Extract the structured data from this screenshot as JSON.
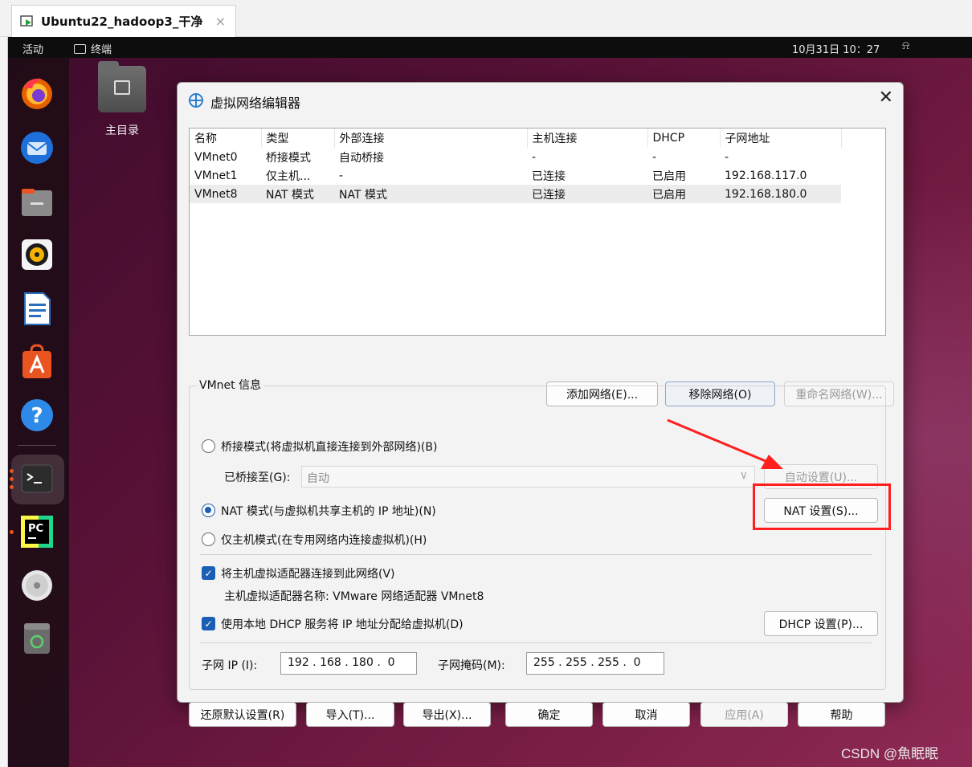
{
  "host": {
    "tab_title": "Ubuntu22_hadoop3_干净",
    "tab_close": "×"
  },
  "ubuntu": {
    "activities": "活动",
    "app_name": "终端",
    "clock": "10月31日 10：27",
    "bell": "⍾",
    "home_label": "主目录"
  },
  "dock": {
    "items": [
      "firefox-icon",
      "thunderbird-icon",
      "files-icon",
      "rhythmbox-icon",
      "libreoffice-writer-icon",
      "app-center-icon",
      "help-icon",
      "terminal-icon",
      "pycharm-icon",
      "optical-disc-icon",
      "trash-icon"
    ]
  },
  "dialog": {
    "title": "虚拟网络编辑器",
    "close": "✕",
    "table": {
      "headers": [
        "名称",
        "类型",
        "外部连接",
        "主机连接",
        "DHCP",
        "子网地址"
      ],
      "rows": [
        [
          "VMnet0",
          "桥接模式",
          "自动桥接",
          "-",
          "-",
          "-"
        ],
        [
          "VMnet1",
          "仅主机...",
          "-",
          "已连接",
          "已启用",
          "192.168.117.0"
        ],
        [
          "VMnet8",
          "NAT 模式",
          "NAT 模式",
          "已连接",
          "已启用",
          "192.168.180.0"
        ]
      ]
    },
    "table_buttons": {
      "add": "添加网络(E)...",
      "remove": "移除网络(O)",
      "rename": "重命名网络(W)..."
    },
    "group_label": "VMnet 信息",
    "bridge_radio": "桥接模式(将虚拟机直接连接到外部网络)(B)",
    "bridged_to_label": "已桥接至(G):",
    "bridged_to_value": "自动",
    "auto_settings": "自动设置(U)...",
    "nat_radio": "NAT 模式(与虚拟机共享主机的 IP 地址)(N)",
    "nat_settings": "NAT 设置(S)...",
    "host_only_radio": "仅主机模式(在专用网络内连接虚拟机)(H)",
    "connect_adapter": "将主机虚拟适配器连接到此网络(V)",
    "adapter_name": "主机虚拟适配器名称: VMware 网络适配器 VMnet8",
    "use_dhcp": "使用本地 DHCP 服务将 IP 地址分配给虚拟机(D)",
    "dhcp_settings": "DHCP 设置(P)...",
    "subnet_ip_label": "子网 IP (I):",
    "subnet_ip": "192 . 168 . 180 .  0",
    "subnet_mask_label": "子网掩码(M):",
    "subnet_mask": "255 . 255 . 255 .  0",
    "footer": {
      "restore": "还原默认设置(R)",
      "import": "导入(T)...",
      "export": "导出(X)...",
      "ok": "确定",
      "cancel": "取消",
      "apply": "应用(A)",
      "help": "帮助"
    }
  },
  "annotation": {
    "highlight_color": "#ff1f1f"
  },
  "watermark": "CSDN @魚眠眠"
}
